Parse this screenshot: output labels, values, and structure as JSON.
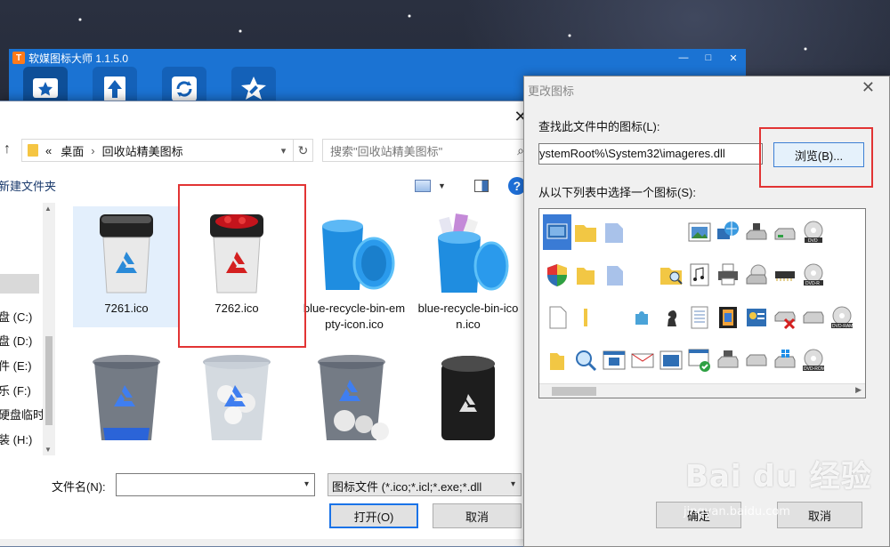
{
  "app": {
    "title": "软媒图标大师 1.1.5.0",
    "logo_text": "T",
    "win_min": "—",
    "win_max": "□",
    "win_close": "✕",
    "toolbar": [
      "star-icon",
      "upload-icon",
      "refresh-icon",
      "wrench-icon"
    ]
  },
  "file_dialog": {
    "close": "✕",
    "up_arrow": "↑",
    "address": {
      "prefix": "«",
      "crumbs": [
        "桌面",
        "回收站精美图标"
      ],
      "separator": "›"
    },
    "refresh": "↻",
    "search_placeholder": "搜索\"回收站精美图标\"",
    "search_icon": "⌕",
    "new_folder": "新建文件夹",
    "help": "?",
    "nav_items": [
      "盘 (C:)",
      "盘 (D:)",
      "件 (E:)",
      "乐 (F:)",
      "硬盘临时",
      "装 (H:)"
    ],
    "files": [
      {
        "name": "7261.ico",
        "icon": "recycle-bin-black-lid-icon",
        "selected": true
      },
      {
        "name": "7262.ico",
        "icon": "recycle-bin-red-lid-icon",
        "selected": false
      },
      {
        "name": "blue-recycle-bin-empty-icon.ico",
        "icon": "blue-recycle-bin-empty-icon",
        "selected": false
      },
      {
        "name": "blue-recycle-bin-icon.ico",
        "icon": "blue-recycle-bin-full-icon",
        "selected": false
      },
      {
        "name": "",
        "icon": "glass-recycle-bin-empty-icon",
        "selected": false
      },
      {
        "name": "",
        "icon": "glass-recycle-bin-paper-icon",
        "selected": false
      },
      {
        "name": "",
        "icon": "glass-recycle-bin-full-icon",
        "selected": false
      },
      {
        "name": "",
        "icon": "black-recycle-bin-icon",
        "selected": false
      }
    ],
    "filename_label": "文件名(N):",
    "filename_value": "",
    "filetype": "图标文件 (*.ico;*.icl;*.exe;*.dll",
    "open_button": "打开(O)",
    "cancel_button": "取消"
  },
  "icon_dialog": {
    "title": "更改图标",
    "close": "✕",
    "find_label": "查找此文件中的图标(L):",
    "path": "ystemRoot%\\System32\\imageres.dll",
    "browse_button": "浏览(B)...",
    "list_label": "从以下列表中选择一个图标(S):",
    "ok_button": "确定",
    "cancel_button": "取消"
  },
  "watermark": {
    "main": "Bai du 经验",
    "sub": "jingyan.baidu.com"
  },
  "colors": {
    "accent": "#1b73d3",
    "highlight": "#e23434",
    "selection": "#e3effc"
  }
}
